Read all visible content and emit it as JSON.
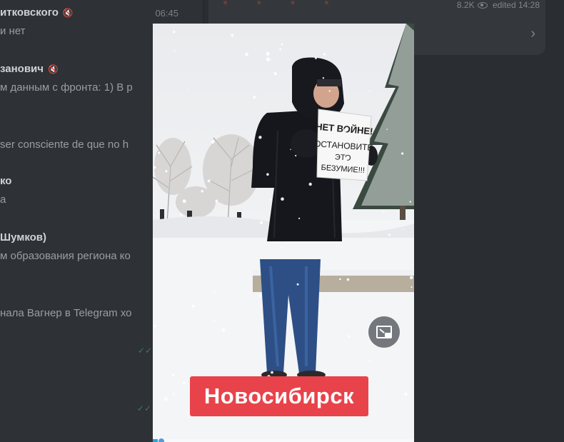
{
  "chats": [
    {
      "name": "итковского",
      "time": "06:45",
      "preview": "и нет",
      "muted": true
    },
    {
      "name": "занович",
      "time": "",
      "preview": "м данным с фронта: 1) В р",
      "muted": true
    },
    {
      "name": "",
      "time": "",
      "preview": "ser consciente de que no h",
      "muted": false
    },
    {
      "name": "ко",
      "time": "",
      "preview": "а",
      "muted": false
    },
    {
      "name": "Шумков)",
      "time": "",
      "preview": "м образования региона ко",
      "muted": false
    },
    {
      "name": "",
      "time": "",
      "preview": "нала Вагнер в Telegram хо",
      "muted": false
    }
  ],
  "post": {
    "views": "8.2K",
    "edited": "edited 14:28",
    "icons": {
      "views": "eye-icon",
      "open": "chevron-right-icon"
    }
  },
  "viewer": {
    "sign_lines": [
      "НЕТ ВОЙНЕ!",
      "ОСТАНОВИТЕ",
      "ЭТО",
      "БЕЗУМИЕ!!!"
    ],
    "caption": "Новосибирск",
    "pip_icon": "picture-in-picture-icon",
    "progress_fraction": 0.02,
    "colors": {
      "caption_bg": "#e8434a",
      "progress": "#2aa3e0"
    }
  }
}
